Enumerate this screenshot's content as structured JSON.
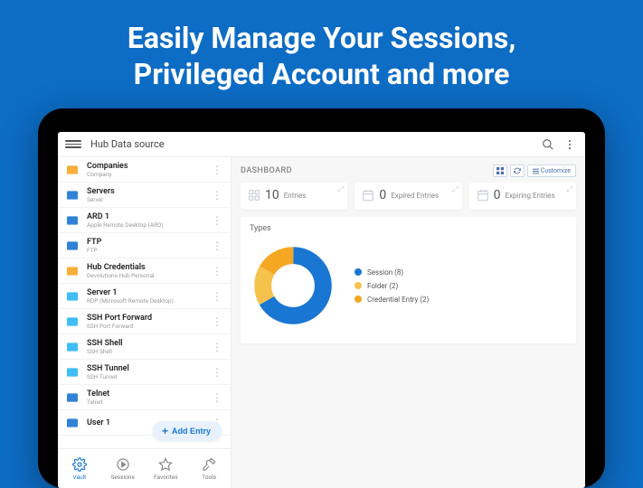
{
  "hero": {
    "line1": "Easily Manage Your Sessions,",
    "line2": "Privileged Account and more"
  },
  "header": {
    "title": "Hub Data source"
  },
  "sidebar": {
    "items": [
      {
        "name": "Companies",
        "sub": "Company",
        "iconColor": "#f5a623",
        "iconBg": "#fff"
      },
      {
        "name": "Servers",
        "sub": "Server",
        "iconColor": "#1976d2",
        "iconBg": "#fff"
      },
      {
        "name": "ARD 1",
        "sub": "Apple Remote Desktop (ARD)",
        "iconColor": "#1976d2",
        "iconBg": "#fff"
      },
      {
        "name": "FTP",
        "sub": "FTP",
        "iconColor": "#1976d2",
        "iconBg": "#fff"
      },
      {
        "name": "Hub Credentials",
        "sub": "Devolutions Hub Personal",
        "iconColor": "#f5a623",
        "iconBg": "#fff"
      },
      {
        "name": "Server 1",
        "sub": "RDP (Microsoft Remote Desktop)",
        "iconColor": "#29b6f6",
        "iconBg": "#fff"
      },
      {
        "name": "SSH Port Forward",
        "sub": "SSH Port Forward",
        "iconColor": "#29b6f6",
        "iconBg": "#fff"
      },
      {
        "name": "SSH Shell",
        "sub": "SSH Shell",
        "iconColor": "#29b6f6",
        "iconBg": "#fff"
      },
      {
        "name": "SSH Tunnel",
        "sub": "SSH Tunnel",
        "iconColor": "#29b6f6",
        "iconBg": "#fff"
      },
      {
        "name": "Telnet",
        "sub": "Telnet",
        "iconColor": "#1976d2",
        "iconBg": "#fff"
      },
      {
        "name": "User 1",
        "sub": "",
        "iconColor": "#1976d2",
        "iconBg": "#fff"
      }
    ],
    "addEntryLabel": "Add Entry"
  },
  "bottomNav": [
    {
      "label": "Vault",
      "active": true
    },
    {
      "label": "Sessions",
      "active": false
    },
    {
      "label": "Favorites",
      "active": false
    },
    {
      "label": "Tools",
      "active": false
    }
  ],
  "dashboard": {
    "title": "DASHBOARD",
    "customizeLabel": "Customize",
    "stats": [
      {
        "count": "10",
        "label": "Entries"
      },
      {
        "count": "0",
        "label": "Expired Entries"
      },
      {
        "count": "0",
        "label": "Expiring Entries"
      }
    ],
    "typesTitle": "Types"
  },
  "chart_data": {
    "type": "pie",
    "title": "Types",
    "series": [
      {
        "name": "Session",
        "value": 8,
        "color": "#1976d2"
      },
      {
        "name": "Folder",
        "value": 2,
        "color": "#f5c24c"
      },
      {
        "name": "Credential Entry",
        "value": 2,
        "color": "#f5a623"
      }
    ],
    "legend_labels": [
      "Session (8)",
      "Folder (2)",
      "Credential Entry (2)"
    ]
  }
}
